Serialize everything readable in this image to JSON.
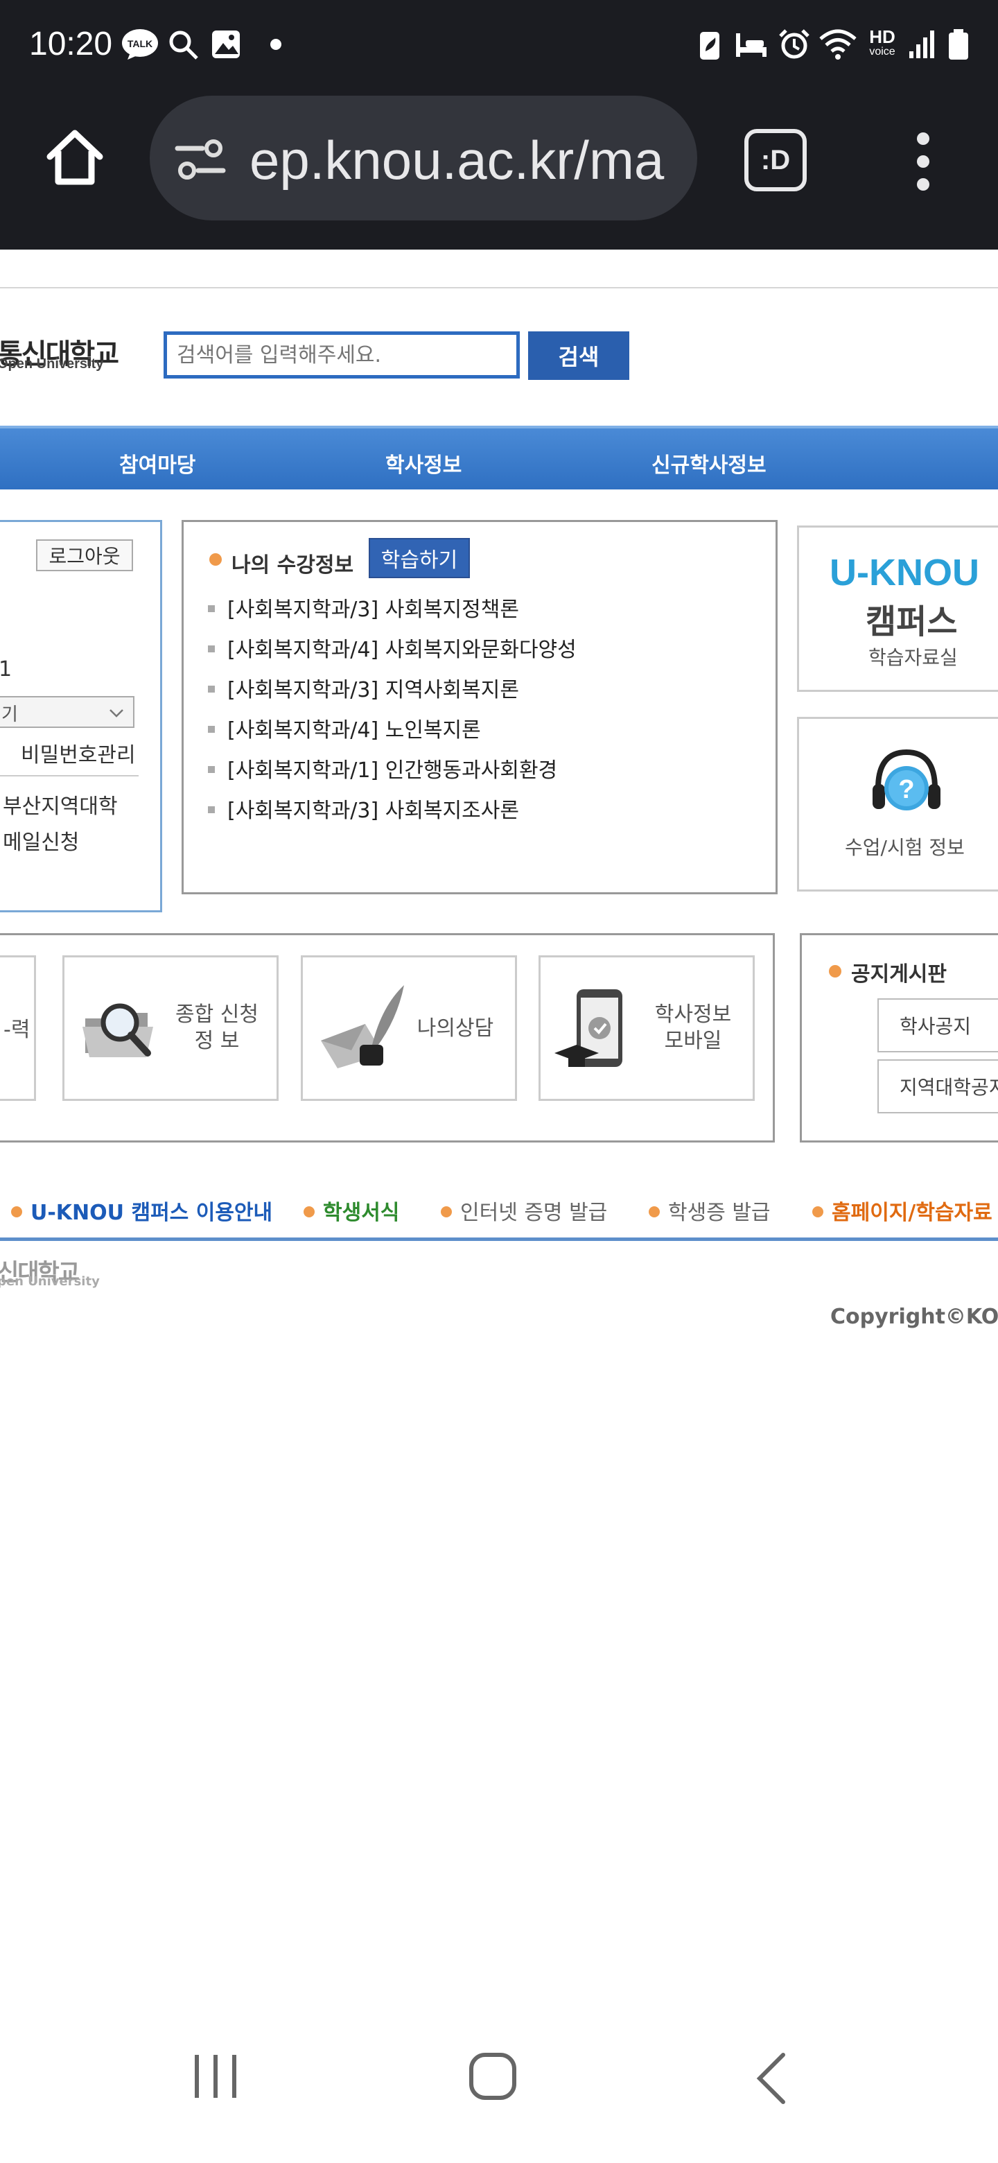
{
  "status_bar": {
    "time": "10:20",
    "left_icons": [
      "talk-icon",
      "search-icon",
      "gallery-icon",
      "dot-icon"
    ],
    "right_icons": [
      "battery-saver-icon",
      "sleep-icon",
      "alarm-icon",
      "wifi-icon",
      "hd-voice-icon",
      "signal-icon",
      "battery-icon"
    ],
    "hd_label": "HD",
    "voice_label": "voice",
    "talk_label": "TALK"
  },
  "browser": {
    "url": "ep.knou.ac.kr/ma",
    "tab_label": ":D"
  },
  "header": {
    "logo_ko": "통신대학교",
    "logo_en": "Open University",
    "search_placeholder": "검색어를 입력해주세요.",
    "search_button": "검색"
  },
  "nav": {
    "items": [
      "참여마당",
      "학사정보",
      "신규학사정보"
    ]
  },
  "login_panel": {
    "logout": "로그아웃",
    "number_fragment": "1",
    "select_value": "기",
    "password_manage": "비밀번호관리",
    "region": "부산지역대학",
    "mail": "메일신청"
  },
  "courses": {
    "title": "나의 수강정보",
    "study_button": "학습하기",
    "items": [
      "[사회복지학과/3] 사회복지정책론",
      "[사회복지학과/4] 사회복지와문화다양성",
      "[사회복지학과/3] 지역사회복지론",
      "[사회복지학과/4] 노인복지론",
      "[사회복지학과/1] 인간행동과사회환경",
      "[사회복지학과/3] 사회복지조사론"
    ]
  },
  "side_panels": {
    "uknou_logo": "U-KNOU",
    "uknou_campus": "캠퍼스",
    "uknou_sub": "학습자료실",
    "exam_info": "수업/시험 정보"
  },
  "quick_menu": {
    "fragment": "-력",
    "cards": [
      {
        "line1": "종합 신청",
        "line2": "정 보"
      },
      {
        "line1": "나의상담",
        "line2": ""
      },
      {
        "line1": "학사정보",
        "line2": "모바일"
      }
    ]
  },
  "notice": {
    "title": "공지게시판",
    "buttons": [
      "학사공지",
      "지역대학공지"
    ]
  },
  "footer_links": [
    {
      "label": "U-KNOU 캠퍼스 이용안내",
      "color": "#1c5bb8"
    },
    {
      "label": "학생서식",
      "color": "#2e8b2e"
    },
    {
      "label": "인터넷 증명 발급",
      "color": "#666666"
    },
    {
      "label": "학생증 발급",
      "color": "#666666"
    },
    {
      "label": "홈페이지/학습자료",
      "color": "#e06a10"
    }
  ],
  "footer": {
    "logo_ko": "신대학교",
    "logo_en": "pen University",
    "copyright": "Copyright©KO"
  },
  "system_nav": [
    "recents-button",
    "home-button",
    "back-button"
  ]
}
